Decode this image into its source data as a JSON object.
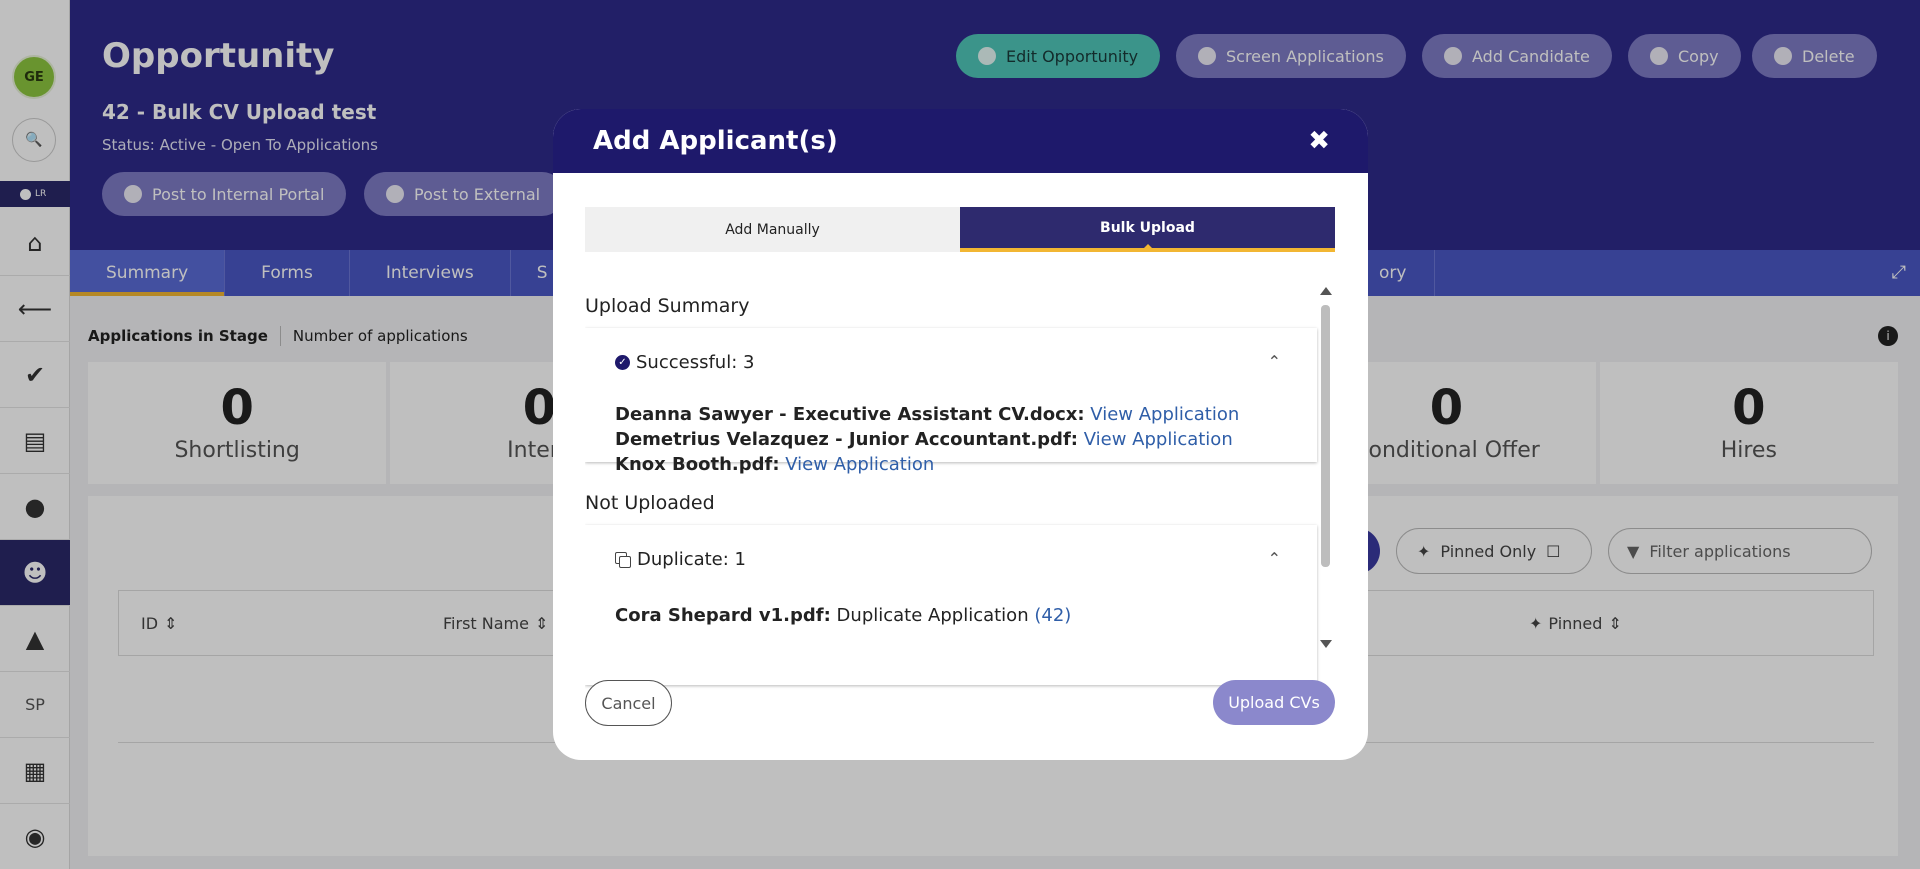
{
  "sidebar": {
    "avatar_initials": "GE",
    "toggle_label": "LR",
    "sp_label": "SP"
  },
  "header": {
    "title": "Opportunity",
    "subtitle": "42 - Bulk CV Upload test",
    "status": "Status: Active - Open To Applications",
    "buttons": {
      "edit": "Edit Opportunity",
      "screen": "Screen Applications",
      "add_candidate": "Add Candidate",
      "copy": "Copy",
      "delete": "Delete",
      "post_internal": "Post to Internal Portal",
      "post_external": "Post to External"
    }
  },
  "tabs": {
    "summary": "Summary",
    "forms": "Forms",
    "interviews": "Interviews",
    "partial_s": "S",
    "partial_history": "ory"
  },
  "stage": {
    "label": "Applications in Stage",
    "sub": "Number of applications"
  },
  "stats": [
    {
      "num": "0",
      "label": "Shortlisting"
    },
    {
      "num": "0",
      "label": "Interv"
    },
    {
      "num": "0",
      "label": "Conditional Offer"
    },
    {
      "num": "0",
      "label": "Hires"
    }
  ],
  "list_controls": {
    "pinned_only": "Pinned Only",
    "filter_placeholder": "Filter applications"
  },
  "table": {
    "col_id": "ID",
    "col_first_name": "First Name",
    "col_pinned": "Pinned"
  },
  "modal": {
    "title": "Add Applicant(s)",
    "tab_manual": "Add Manually",
    "tab_bulk": "Bulk Upload",
    "upload_summary_title": "Upload Summary",
    "successful_label": "Successful: 3",
    "successful_items": [
      {
        "file": "Deanna Sawyer - Executive Assistant CV.docx:",
        "link": "View Application"
      },
      {
        "file": "Demetrius Velazquez - Junior Accountant.pdf:",
        "link": "View Application"
      },
      {
        "file": "Knox Booth.pdf:",
        "link": "View Application"
      }
    ],
    "not_uploaded_title": "Not Uploaded",
    "duplicate_label": "Duplicate: 1",
    "duplicate_item": {
      "file": "Cora Shepard v1.pdf:",
      "text": "Duplicate Application",
      "link": "(42)"
    },
    "cancel": "Cancel",
    "upload": "Upload CVs"
  }
}
